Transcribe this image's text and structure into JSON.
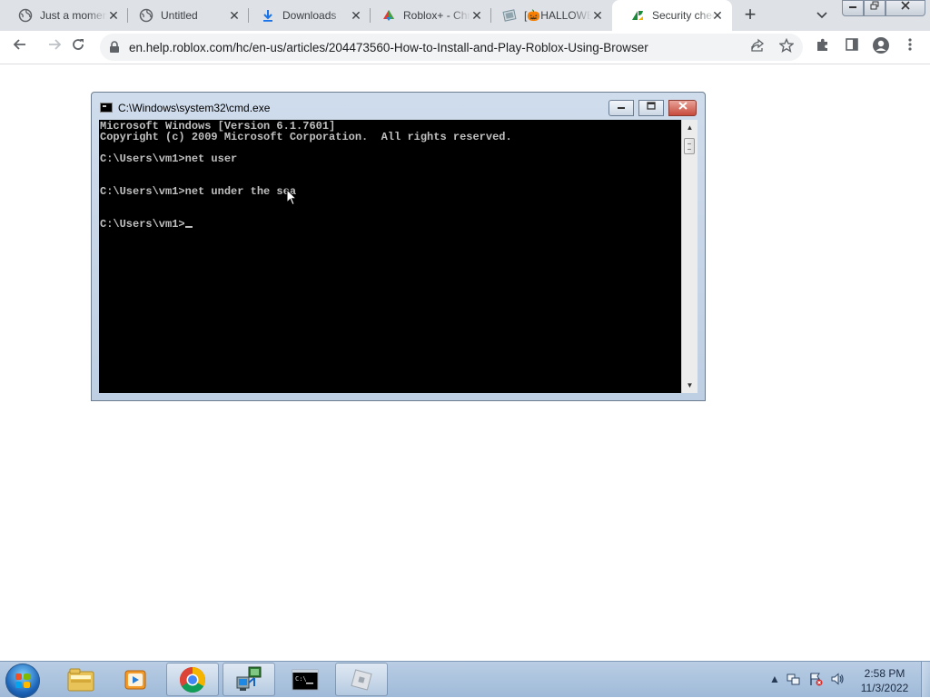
{
  "browser": {
    "tabs": [
      {
        "label": "Just a moment...",
        "icon": "globe-icon",
        "active": false
      },
      {
        "label": "Untitled",
        "icon": "globe-icon",
        "active": false
      },
      {
        "label": "Downloads",
        "icon": "download-icon",
        "active": false
      },
      {
        "label": "Roblox+ - Chrome",
        "icon": "roblox-plus-icon",
        "active": false
      },
      {
        "label": "[🎃HALLOWEEN",
        "icon": "page-icon",
        "active": false
      },
      {
        "label": "Security check",
        "icon": "zendesk-icon",
        "active": true
      }
    ],
    "new_tab_label": "+",
    "address_bar": {
      "url": "en.help.roblox.com/hc/en-us/articles/204473560-How-to-Install-and-Play-Roblox-Using-Browser"
    },
    "accent_color": "#1a73e8"
  },
  "cmd": {
    "title": "C:\\Windows\\system32\\cmd.exe",
    "lines": [
      "Microsoft Windows [Version 6.1.7601]",
      "Copyright (c) 2009 Microsoft Corporation.  All rights reserved.",
      "",
      "C:\\Users\\vm1>net user",
      "",
      "",
      "C:\\Users\\vm1>net under the sea",
      "",
      "",
      "C:\\Users\\vm1>"
    ]
  },
  "taskbar": {
    "items": [
      {
        "name": "explorer",
        "icon": "folder-icon",
        "active": false
      },
      {
        "name": "media-player",
        "icon": "media-player-icon",
        "active": false
      },
      {
        "name": "chrome",
        "icon": "chrome-icon",
        "active": true
      },
      {
        "name": "network-tool",
        "icon": "network-computer-icon",
        "active": true
      },
      {
        "name": "cmd",
        "icon": "cmd-icon",
        "active": false
      },
      {
        "name": "roblox",
        "icon": "roblox-icon",
        "active": true
      }
    ],
    "clock": {
      "time": "2:58 PM",
      "date": "11/3/2022"
    }
  }
}
